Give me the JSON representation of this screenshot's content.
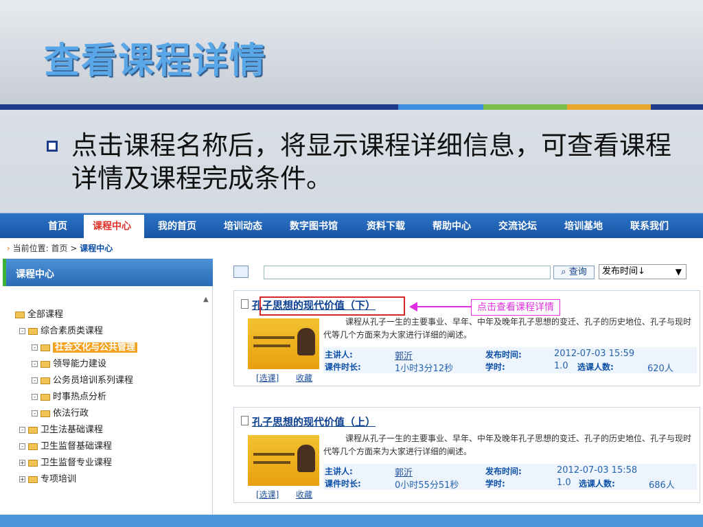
{
  "slide": {
    "title": "查看课程详情",
    "bullet": "点击课程名称后，将显示课程详细信息，可查看课程详情及课程完成条件。",
    "colors": {
      "title": "#5aa7e8",
      "rule": "#1f3b8c",
      "seg1": "#3d8de0",
      "seg2": "#7bbf4a",
      "seg3": "#e6a72a"
    }
  },
  "nav": {
    "items": [
      "首页",
      "课程中心",
      "我的首页",
      "培训动态",
      "数字图书馆",
      "资料下载",
      "帮助中心",
      "交流论坛",
      "培训基地",
      "联系我们"
    ],
    "active": "课程中心"
  },
  "breadcrumb": {
    "prefix": "当前位置:",
    "home": "首页",
    "sep": ">",
    "current": "课程中心"
  },
  "sidebar": {
    "title": "课程中心",
    "items": [
      "全部课程",
      "综合素质类课程",
      "社会文化与公共管理",
      "领导能力建设",
      "公务员培训系列课程",
      "时事热点分析",
      "依法行政",
      "卫生法基础课程",
      "卫生监督基础课程",
      "卫生监督专业课程",
      "专项培训"
    ],
    "selected": "社会文化与公共管理"
  },
  "search": {
    "query_label": "查询",
    "sort_label": "发布时间↓",
    "placeholder": ""
  },
  "courses": [
    {
      "title": "孔子思想的现代价值（下）",
      "desc": "课程从孔子一生的主要事业、早年、中年及晚年孔子思想的变迁、孔子的历史地位、孔子与现时代等几个方面来为大家进行详细的阐述。",
      "lecturer_label": "主讲人:",
      "lecturer": "郭沂",
      "duration_label": "课件时长:",
      "duration": "1小时3分12秒",
      "date_label": "发布时间:",
      "date": "2012-07-03 15:59",
      "credit_label": "学时:",
      "credit": "1.0",
      "count_label": "选课人数:",
      "count": "620人",
      "select_label": "[选课]",
      "fav_label": "收藏"
    },
    {
      "title": "孔子思想的现代价值（上）",
      "desc": "课程从孔子一生的主要事业、早年、中年及晚年孔子思想的变迁、孔子的历史地位、孔子与现时代等几个方面来为大家进行详细的阐述。",
      "lecturer_label": "主讲人:",
      "lecturer": "郭沂",
      "duration_label": "课件时长:",
      "duration": "0小时55分51秒",
      "date_label": "发布时间:",
      "date": "2012-07-03 15:58",
      "credit_label": "学时:",
      "credit": "1.0",
      "count_label": "选课人数:",
      "count": "686人",
      "select_label": "[选课]",
      "fav_label": "收藏"
    }
  ],
  "callout": "点击查看课程详情"
}
